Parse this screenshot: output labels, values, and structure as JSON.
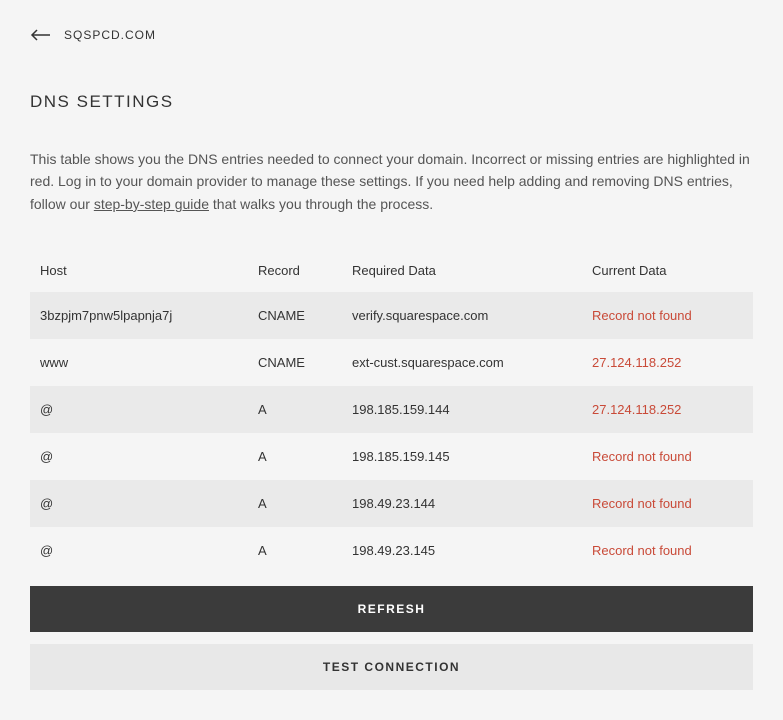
{
  "header": {
    "domain_name": "SQSPCD.COM"
  },
  "page_title": "DNS SETTINGS",
  "description": {
    "text_before": "This table shows you the DNS entries needed to connect your domain. Incorrect or missing entries are highlighted in red. Log in to your domain provider to manage these settings. If you need help adding and removing DNS entries, follow our ",
    "link_text": "step-by-step guide",
    "text_after": " that walks you through the process."
  },
  "table": {
    "headers": {
      "host": "Host",
      "record": "Record",
      "required": "Required Data",
      "current": "Current Data"
    },
    "rows": [
      {
        "host": "3bzpjm7pnw5lpapnja7j",
        "record": "CNAME",
        "required": "verify.squarespace.com",
        "current": "Record not found",
        "error": true
      },
      {
        "host": "www",
        "record": "CNAME",
        "required": "ext-cust.squarespace.com",
        "current": "27.124.118.252",
        "error": true
      },
      {
        "host": "@",
        "record": "A",
        "required": "198.185.159.144",
        "current": "27.124.118.252",
        "error": true
      },
      {
        "host": "@",
        "record": "A",
        "required": "198.185.159.145",
        "current": "Record not found",
        "error": true
      },
      {
        "host": "@",
        "record": "A",
        "required": "198.49.23.144",
        "current": "Record not found",
        "error": true
      },
      {
        "host": "@",
        "record": "A",
        "required": "198.49.23.145",
        "current": "Record not found",
        "error": true
      }
    ]
  },
  "buttons": {
    "refresh": "REFRESH",
    "test_connection": "TEST CONNECTION"
  }
}
